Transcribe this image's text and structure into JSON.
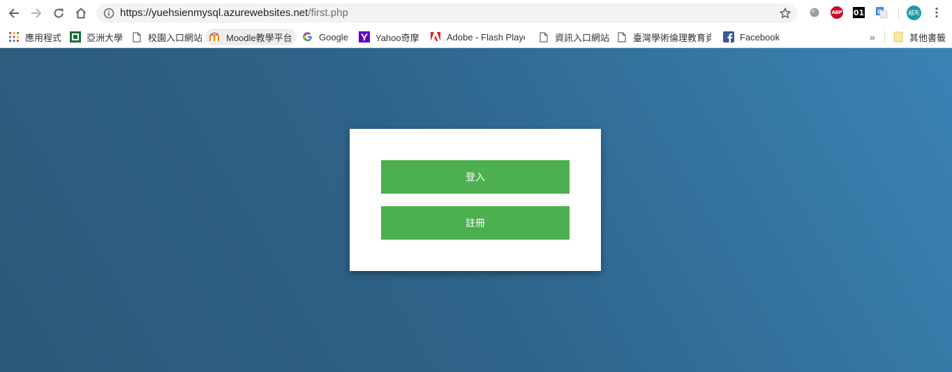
{
  "browser": {
    "url_host": "https://yuehsienmysql.azurewebsites.net",
    "url_path": "/first.php",
    "extensions": {
      "abp_label": "ABP",
      "ext01_label": "01"
    },
    "avatar_text": "越先",
    "overflow_chevron": "»"
  },
  "bookmarks": [
    {
      "label": "應用程式",
      "icon": "apps-grid-icon"
    },
    {
      "label": "亞洲大學",
      "icon": "asia-university-icon"
    },
    {
      "label": "校園入口網站",
      "icon": "page-icon"
    },
    {
      "label": "Moodle教學平台",
      "icon": "moodle-icon"
    },
    {
      "label": "Google",
      "icon": "google-icon"
    },
    {
      "label": "Yahoo奇摩",
      "icon": "yahoo-icon"
    },
    {
      "label": "Adobe - Flash Playe",
      "icon": "adobe-icon"
    },
    {
      "label": "資訊入口網站",
      "icon": "page-icon"
    },
    {
      "label": "臺灣學術倫理教育資",
      "icon": "page-icon"
    },
    {
      "label": "Facebook",
      "icon": "facebook-icon"
    }
  ],
  "other_bookmarks": {
    "label": "其他書籤",
    "icon": "folder-icon"
  },
  "main": {
    "login_label": "登入",
    "register_label": "註冊"
  },
  "colors": {
    "button_green": "#4caf50",
    "page_gradient_dark": "#2b5878",
    "page_gradient_light": "#3a83b5"
  }
}
